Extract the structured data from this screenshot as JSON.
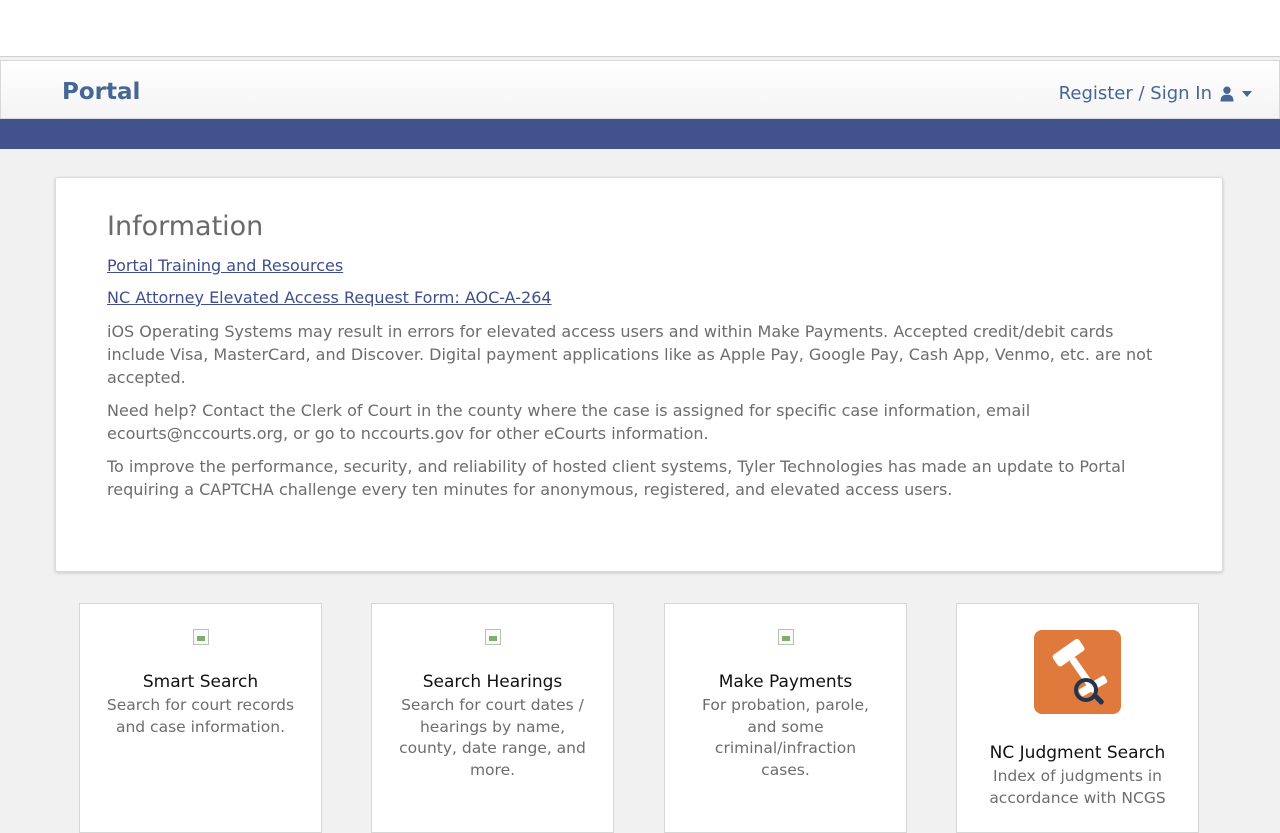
{
  "header": {
    "brand": "Portal",
    "signin_label": "Register / Sign In"
  },
  "info": {
    "title": "Information",
    "links": [
      "Portal Training and Resources",
      "NC Attorney Elevated Access Request Form: AOC-A-264"
    ],
    "paragraphs": [
      "iOS Operating Systems may result in errors for elevated access users and within Make Payments. Accepted credit/debit cards include Visa, MasterCard, and Discover. Digital payment applications like as Apple Pay, Google Pay, Cash App, Venmo, etc. are not accepted.",
      "Need help? Contact the Clerk of Court in the county where the case is assigned for specific case information, email ecourts@nccourts.org, or go to nccourts.gov for other eCourts information.",
      "To improve the performance, security, and reliability of hosted client systems, Tyler Technologies has made an update to Portal requiring a CAPTCHA challenge every ten minutes for anonymous, registered, and elevated access users."
    ]
  },
  "tiles": [
    {
      "title": "Smart Search",
      "desc": "Search for court records and case information."
    },
    {
      "title": "Search Hearings",
      "desc": "Search for court dates / hearings by name, county, date range, and more."
    },
    {
      "title": "Make Payments",
      "desc": "For probation, parole, and some criminal/infraction cases."
    },
    {
      "title": "NC Judgment Search",
      "desc": "Index of judgments in accordance with NCGS"
    }
  ],
  "colors": {
    "brand": "#466694",
    "band": "#42528c",
    "judgment_icon": "#e07a3c"
  }
}
